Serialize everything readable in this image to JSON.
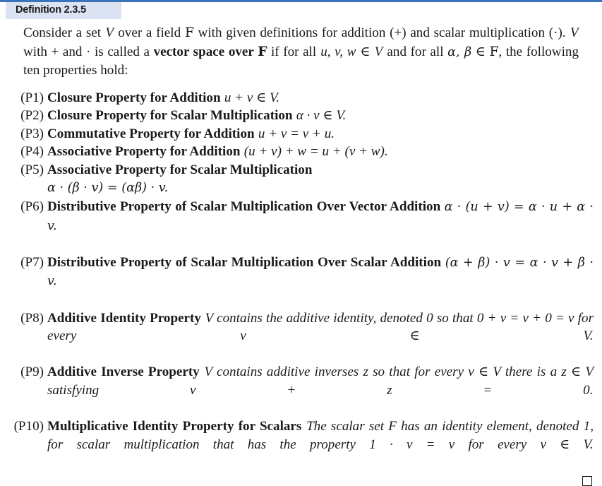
{
  "header": {
    "title": "Definition 2.3.5",
    "tab_background": "#dbe2f2",
    "rule_color": "#3a73b8"
  },
  "intro": {
    "line1_a": "Consider a set ",
    "var_V": "V",
    "line1_b": " over a field ",
    "field_F": "F",
    "line1_c": " with given definitions for addition (+) and scalar multiplication",
    "line2_a": "(·). ",
    "line2_b": " with + and · is called a ",
    "bold_term": "vector space over ",
    "line2_c": " if for all ",
    "vars_uvw": "u, v, w",
    "line2_d": " ∈ ",
    "line2_e": " and for all ",
    "vars_ab": "α, β",
    "line2_f": " ∈ ",
    "line2_g": ", the",
    "line3": "following ten properties hold:"
  },
  "properties": [
    {
      "label": "(P1)",
      "name": "Closure Property for Addition",
      "math": "u + v ∈ V.",
      "full": "(P1) Closure Property for Addition u + v ∈ V."
    },
    {
      "label": "(P2)",
      "name": "Closure Property for Scalar Multiplication",
      "math": "α · v ∈ V.",
      "full": "(P2) Closure Property for Scalar Multiplication α · v ∈ V."
    },
    {
      "label": "(P3)",
      "name": "Commutative Property for Addition",
      "math": "u + v = v + u.",
      "full": "(P3) Commutative Property for Addition u + v = v + u."
    },
    {
      "label": "(P4)",
      "name": "Associative Property for Addition",
      "math": "(u + v) + w = u + (v + w).",
      "full": "(P4) Associative Property for Addition (u + v) + w = u + (v + w)."
    },
    {
      "label": "(P5)",
      "name": "Associative Property for Scalar Multiplication",
      "math": "α · (β · v) = (αβ) · v.",
      "full": "(P5) Associative Property for Scalar Multiplication α · (β · v) = (αβ) · v."
    },
    {
      "label": "(P6)",
      "name": "Distributive Property of Scalar Multiplication Over Vector Addition",
      "math": "α · (u + v) = α · u + α · v.",
      "full": "(P6) Distributive Property of Scalar Multiplication Over Vector Addition α · (u + v) = α · u + α · v."
    },
    {
      "label": "(P7)",
      "name": "Distributive Property of Scalar Multiplication Over Scalar Addition",
      "math": "(α + β) · v = α · v + β · v.",
      "full": "(P7) Distributive Property of Scalar Multiplication Over Scalar Addition (α + β) · v = α · v + β · v."
    },
    {
      "label": "(P8)",
      "name": "Additive Identity Property",
      "math": "V contains the additive identity, denoted 0 so that 0 + v = v + 0 = v for every v ∈ V.",
      "full": "(P8) Additive Identity Property V contains the additive identity, denoted 0 so that 0 + v = v + 0 = v for every v ∈ V."
    },
    {
      "label": "(P9)",
      "name": "Additive Inverse Property",
      "math": "V contains additive inverses z so that for every v ∈ V there is a z ∈ V satisfying v + z = 0.",
      "full": "(P9) Additive Inverse Property V contains additive inverses z so that for every v ∈ V there is a z ∈ V satisfying v + z = 0."
    },
    {
      "label": "(P10)",
      "name": "Multiplicative Identity Property for Scalars",
      "math": "The scalar set F has an identity element, denoted 1, for scalar multiplication that has the property 1 · v = v for every v ∈ V.",
      "full": "(P10) Multiplicative Identity Property for Scalars The scalar set F has an identity element, denoted 1, for scalar multiplication that has the property 1 · v = v for every v ∈ V."
    }
  ],
  "end_marker": "□"
}
